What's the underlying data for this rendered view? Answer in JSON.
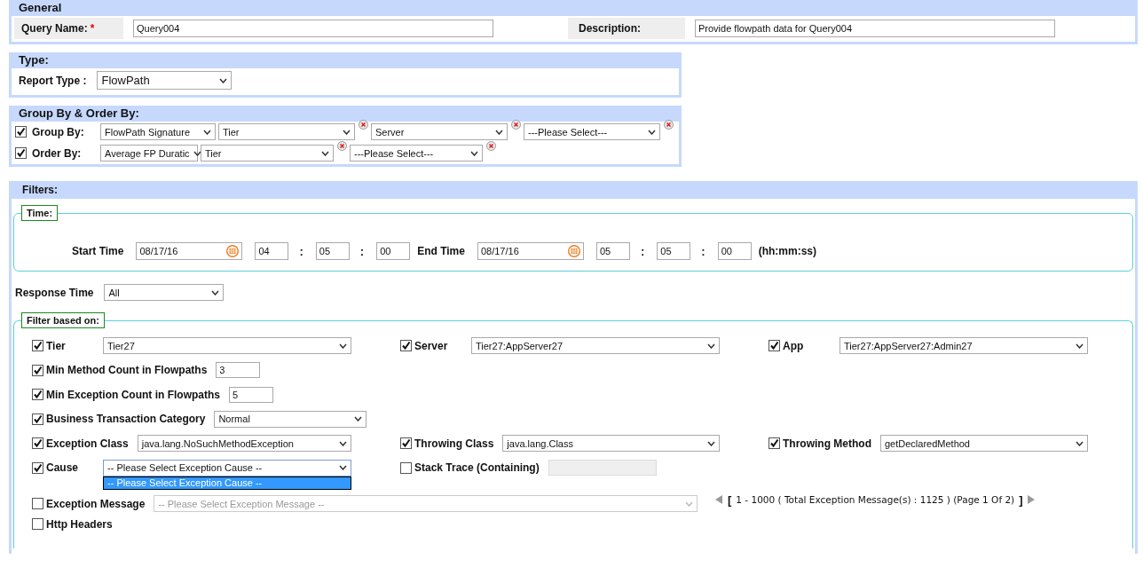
{
  "general": {
    "title": "General",
    "fields": [
      {
        "label": "Query Name:",
        "required": "*",
        "value": "Query004"
      },
      {
        "label": "Description:",
        "value": "Provide flowpath data for Query004"
      }
    ]
  },
  "type": {
    "title": "Type:",
    "label": "Report Type :",
    "value": "FlowPath"
  },
  "group_order": {
    "title": "Group By & Order By:",
    "rows": [
      {
        "label": "Group By:",
        "checked": true,
        "selects": [
          {
            "value": "FlowPath Signature",
            "removable": false
          },
          {
            "value": "Tier",
            "removable": true
          },
          {
            "value": "Server",
            "removable": true
          },
          {
            "value": "---Please Select---",
            "removable": true
          }
        ]
      },
      {
        "label": "Order By:",
        "checked": true,
        "selects": [
          {
            "value": "Average FP Duratic",
            "removable": false
          },
          {
            "value": "Tier",
            "removable": true
          },
          {
            "value": "---Please Select---",
            "removable": true
          }
        ]
      }
    ]
  },
  "filters": {
    "title": "Filters:",
    "time": {
      "legend": "Time:",
      "ranges": [
        {
          "label": "Start Time",
          "date": "08/17/16",
          "hh": "04",
          "sep1": ":",
          "mm": "05",
          "sep2": ":",
          "ss": "00"
        },
        {
          "label": "End Time",
          "date": "08/17/16",
          "hh": "05",
          "sep1": ":",
          "mm": "05",
          "sep2": ":",
          "ss": "00"
        }
      ],
      "format": "(hh:mm:ss)"
    },
    "response_time": {
      "label": "Response Time",
      "value": "All"
    },
    "filter_based_on": {
      "legend": "Filter based on:",
      "rows": [
        {
          "items": [
            {
              "kind": "select",
              "label": "Tier",
              "checked": true,
              "value": "Tier27"
            },
            {
              "kind": "select",
              "label": "Server",
              "checked": true,
              "value": "Tier27:AppServer27"
            },
            {
              "kind": "select",
              "label": "App",
              "checked": true,
              "value": "Tier27:AppServer27:Admin27"
            }
          ]
        },
        {
          "items": [
            {
              "kind": "input",
              "label": "Min Method Count in Flowpaths",
              "checked": true,
              "value": "3"
            }
          ]
        },
        {
          "items": [
            {
              "kind": "input",
              "label": "Min Exception Count in Flowpaths",
              "checked": true,
              "value": "5"
            }
          ]
        },
        {
          "items": [
            {
              "kind": "select",
              "label": "Business Transaction Category",
              "checked": true,
              "value": "Normal"
            }
          ]
        },
        {
          "items": [
            {
              "kind": "select",
              "label": "Exception Class",
              "checked": true,
              "value": "java.lang.NoSuchMethodException"
            },
            {
              "kind": "select",
              "label": "Throwing Class",
              "checked": true,
              "value": "java.lang.Class"
            },
            {
              "kind": "select",
              "label": "Throwing Method",
              "checked": true,
              "value": "getDeclaredMethod"
            }
          ]
        },
        {
          "items": [
            {
              "kind": "select",
              "label": "Cause",
              "checked": true,
              "value": "-- Please Select Exception Cause --",
              "expanded": true,
              "options": [
                {
                  "label": "-- Please Select Exception Cause --",
                  "selected": true
                }
              ]
            },
            {
              "kind": "input",
              "label": "Stack Trace (Containing)",
              "checked": false,
              "disabled": true
            }
          ]
        },
        {
          "items": [
            {
              "kind": "select",
              "label": "Exception Message",
              "checked": false,
              "disabled": true,
              "placeholder": "-- Please Select Exception Message --"
            },
            {
              "kind": "pager",
              "open": "[",
              "text": "1 - 1000 ( Total Exception Message(s) : 1125 ) (Page 1 Of 2)",
              "close": "]"
            }
          ]
        },
        {
          "items": [
            {
              "kind": "check",
              "label": "Http Headers",
              "checked": false
            }
          ]
        }
      ]
    }
  }
}
